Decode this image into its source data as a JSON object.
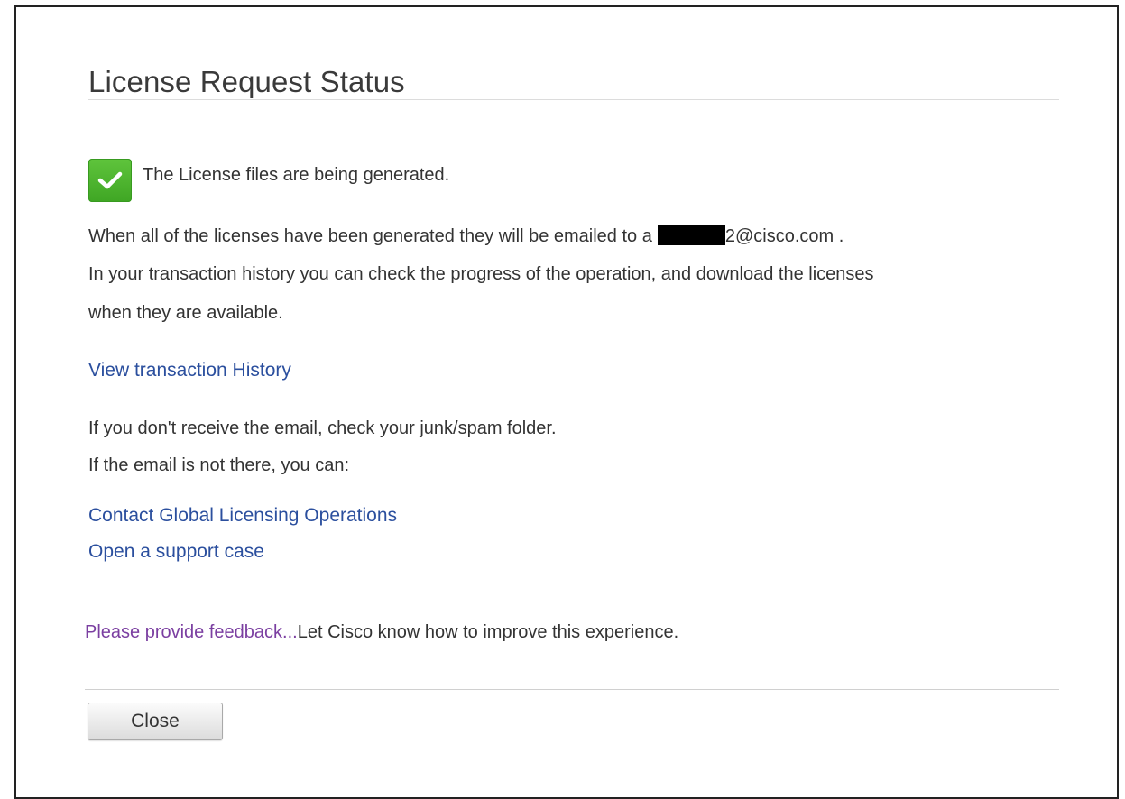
{
  "dialog": {
    "title": "License Request Status",
    "status": {
      "icon": "checkmark-icon",
      "icon_color": "#4cb72f",
      "message": "The License files are being generated."
    },
    "email_line": {
      "prefix": "When all of the licenses have been generated they will be emailed to",
      "partial_visible_char": "a",
      "suffix": "2@cisco.com ."
    },
    "history_lines": [
      "In your transaction history you can check the progress of the operation, and download the licenses",
      "when they are available."
    ],
    "view_history_link": "View transaction History",
    "spam_lines": [
      "If you don't receive the email, check your junk/spam folder.",
      "If the email is not there, you can:"
    ],
    "contact_link": "Contact Global Licensing Operations",
    "support_link": "Open a support case",
    "feedback": {
      "link": "Please provide feedback...",
      "text": "Let Cisco know how to improve this experience."
    },
    "close_button": "Close"
  },
  "colors": {
    "link": "#2b4f9e",
    "feedback_link": "#7b3fa1",
    "text": "#333333"
  }
}
